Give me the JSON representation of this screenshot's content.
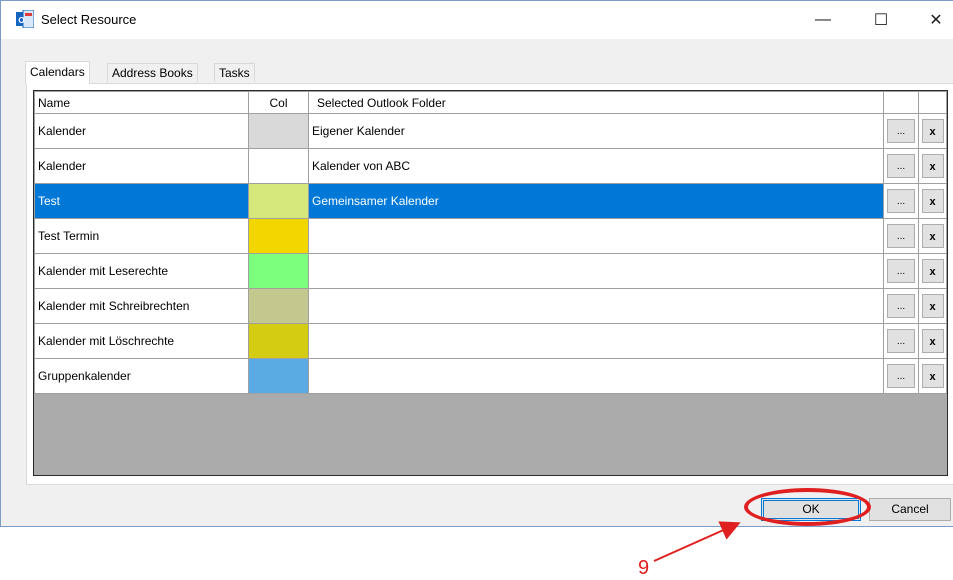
{
  "window": {
    "title": "Select Resource",
    "app_icon": "outlook-app-icon",
    "controls": {
      "minimize": "—",
      "maximize": "☐",
      "close": "✕"
    }
  },
  "tabs": [
    {
      "label": "Calendars",
      "active": true
    },
    {
      "label": "Address Books",
      "active": false
    },
    {
      "label": "Tasks",
      "active": false
    }
  ],
  "grid": {
    "columns": [
      "Name",
      "Col",
      "Selected Outlook Folder"
    ],
    "rows": [
      {
        "name": "Kalender",
        "color": "#d9d9d9",
        "folder": "Eigener Kalender",
        "selected": false
      },
      {
        "name": "Kalender",
        "color": "#ffffff",
        "folder": "Kalender von ABC",
        "selected": false
      },
      {
        "name": "Test",
        "color": "#d6e77c",
        "folder": "Gemeinsamer Kalender",
        "selected": true
      },
      {
        "name": "Test Termin",
        "color": "#f2d600",
        "folder": "",
        "selected": false
      },
      {
        "name": "Kalender mit Leserechte",
        "color": "#7cff7c",
        "folder": "",
        "selected": false
      },
      {
        "name": "Kalender mit Schreibrechten",
        "color": "#c4c88e",
        "folder": "",
        "selected": false
      },
      {
        "name": "Kalender mit Löschrechte",
        "color": "#d4cb13",
        "folder": "",
        "selected": false
      },
      {
        "name": "Gruppenkalender",
        "color": "#5aabe3",
        "folder": "",
        "selected": false
      }
    ],
    "browse_label": "...",
    "clear_label": "x"
  },
  "footer": {
    "ok_label": "OK",
    "cancel_label": "Cancel"
  },
  "annotation": {
    "label": "9",
    "color": "#e02020"
  }
}
